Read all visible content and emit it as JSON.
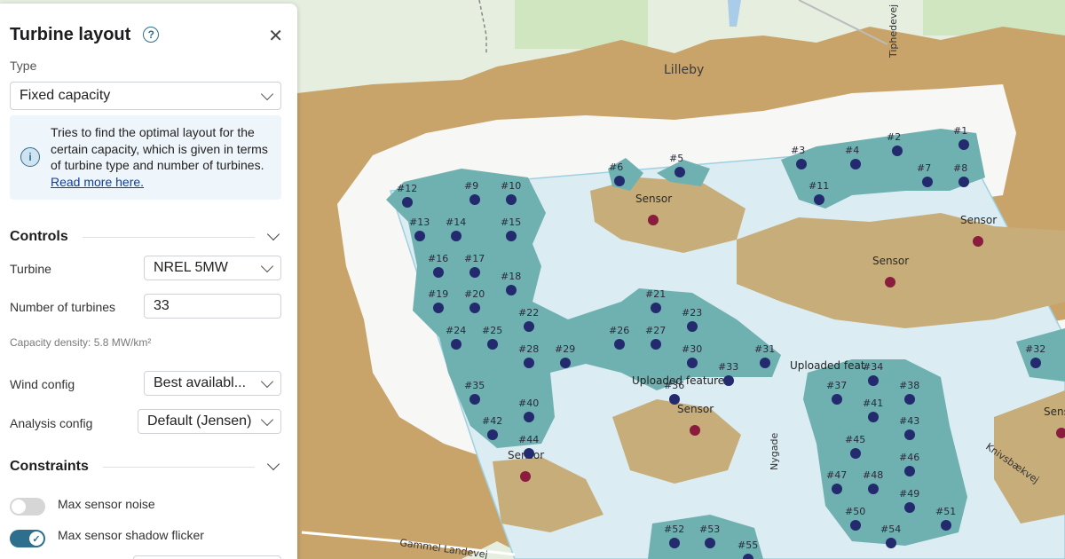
{
  "panel": {
    "title": "Turbine layout",
    "help_icon": "question-circle-icon",
    "close_icon": "close-icon",
    "type_label": "Type",
    "type_value": "Fixed capacity",
    "info_text": "Tries to find the optimal layout for the certain capacity, which is given in terms of turbine type and number of turbines.",
    "info_link": "Read more here.",
    "controls": {
      "title": "Controls",
      "turbine_label": "Turbine",
      "turbine_value": "NREL 5MW",
      "num_turbines_label": "Number of turbines",
      "num_turbines_value": "33",
      "capacity_density": "Capacity density: 5.8 MW/km²",
      "wind_config_label": "Wind config",
      "wind_config_value": "Best availabl...",
      "analysis_config_label": "Analysis config",
      "analysis_config_value": "Default (Jensen)"
    },
    "constraints": {
      "title": "Constraints",
      "max_sensor_noise_label": "Max sensor noise",
      "max_sensor_noise_on": false,
      "max_shadow_flicker_label": "Max sensor shadow flicker",
      "max_shadow_flicker_on": true
    }
  },
  "map": {
    "place_labels": [
      "Lilleby"
    ],
    "road_labels": [
      "Tiphedevej",
      "Nygade",
      "Knivsbækvej",
      "Gammel Landevej"
    ],
    "sensor_label": "Sensor",
    "uploaded_feature_label": "Uploaded feature",
    "uploaded_feature_label_short": "Uploaded feat",
    "turbines": [
      {
        "label": "#1"
      },
      {
        "label": "#2"
      },
      {
        "label": "#3"
      },
      {
        "label": "#4"
      },
      {
        "label": "#5"
      },
      {
        "label": "#6"
      },
      {
        "label": "#7"
      },
      {
        "label": "#8"
      },
      {
        "label": "#9"
      },
      {
        "label": "#10"
      },
      {
        "label": "#11"
      },
      {
        "label": "#12"
      },
      {
        "label": "#13"
      },
      {
        "label": "#14"
      },
      {
        "label": "#15"
      },
      {
        "label": "#16"
      },
      {
        "label": "#17"
      },
      {
        "label": "#18"
      },
      {
        "label": "#19"
      },
      {
        "label": "#20"
      },
      {
        "label": "#21"
      },
      {
        "label": "#22"
      },
      {
        "label": "#23"
      },
      {
        "label": "#24"
      },
      {
        "label": "#25"
      },
      {
        "label": "#26"
      },
      {
        "label": "#27"
      },
      {
        "label": "#28"
      },
      {
        "label": "#29"
      },
      {
        "label": "#30"
      },
      {
        "label": "#31"
      },
      {
        "label": "#32"
      },
      {
        "label": "#33"
      },
      {
        "label": "#34"
      },
      {
        "label": "#35"
      },
      {
        "label": "#36"
      },
      {
        "label": "#37"
      },
      {
        "label": "#38"
      },
      {
        "label": "#40"
      },
      {
        "label": "#41"
      },
      {
        "label": "#42"
      },
      {
        "label": "#43"
      },
      {
        "label": "#44"
      },
      {
        "label": "#45"
      },
      {
        "label": "#46"
      },
      {
        "label": "#47"
      },
      {
        "label": "#48"
      },
      {
        "label": "#49"
      },
      {
        "label": "#50"
      },
      {
        "label": "#51"
      },
      {
        "label": "#52"
      },
      {
        "label": "#53"
      },
      {
        "label": "#54"
      },
      {
        "label": "#55"
      }
    ],
    "colors": {
      "turbine": "#232a6e",
      "sensor": "#8a1c3e",
      "tan": "#c9a46a",
      "teal": "#6fb0b0",
      "light_blue": "#dbecf2",
      "white": "#f7f7f5",
      "green": "#cfe6c0"
    }
  }
}
